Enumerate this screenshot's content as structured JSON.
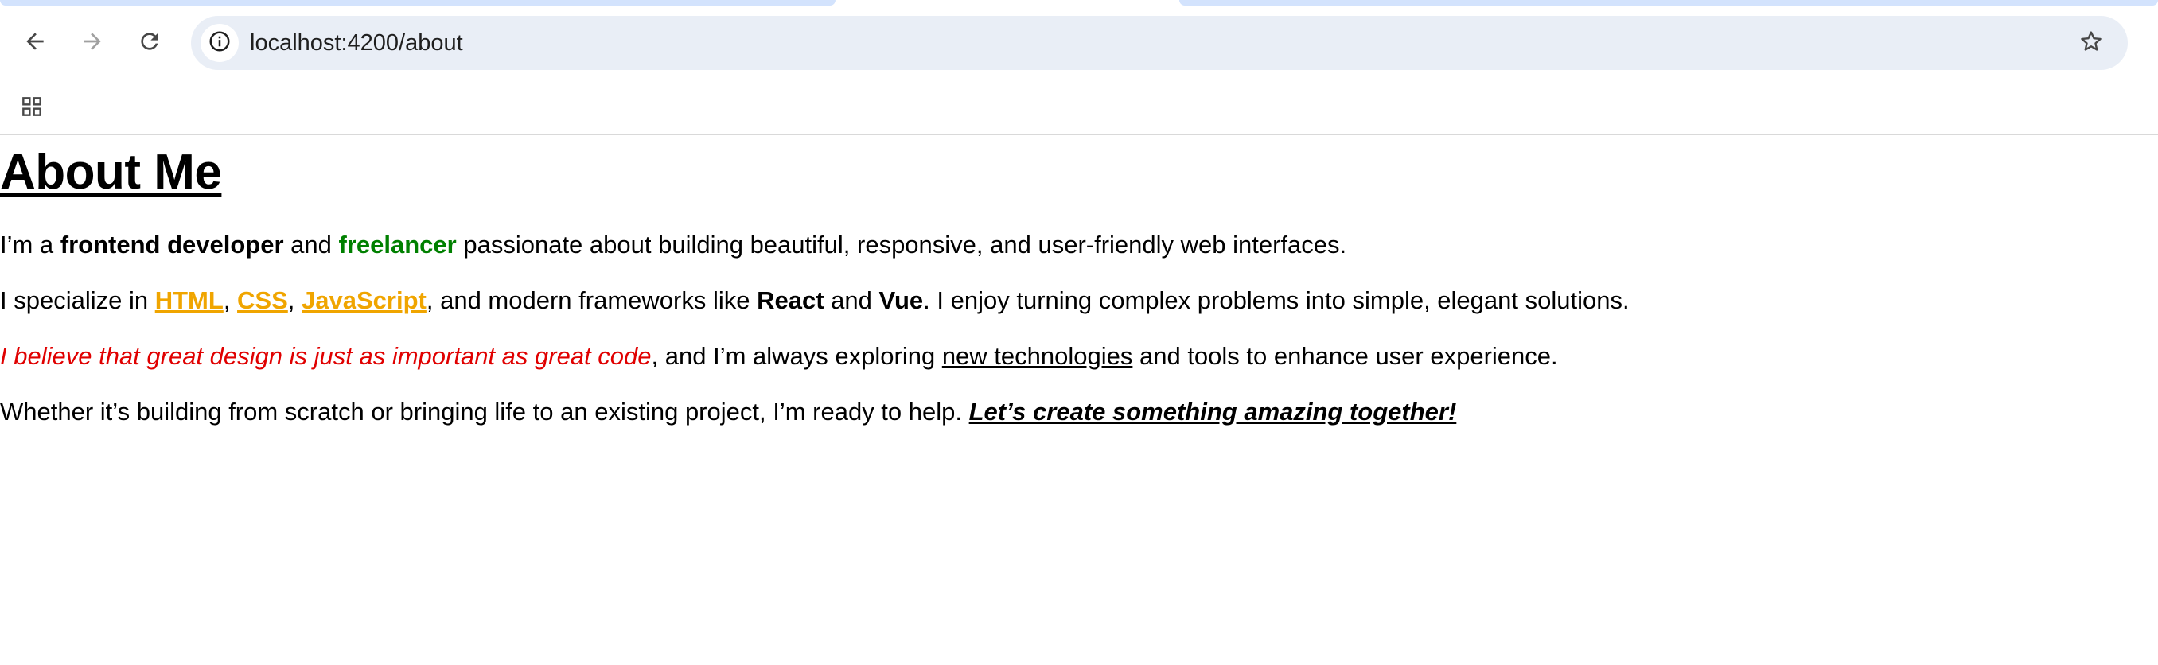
{
  "browser": {
    "url": "localhost:4200/about",
    "icons": {
      "back": "arrow-left-icon",
      "forward": "arrow-right-icon",
      "reload": "reload-icon",
      "site_info": "info-icon",
      "bookmark": "star-icon",
      "apps": "apps-grid-icon"
    }
  },
  "page": {
    "title": "About Me",
    "p1": {
      "t1": "I’m a ",
      "role": "frontend developer",
      "t2": " and ",
      "freelancer": "freelancer",
      "t3": " passionate about building beautiful, responsive, and user-friendly web interfaces."
    },
    "p2": {
      "t1": "I specialize in ",
      "html": "HTML",
      "sep1": ", ",
      "css": "CSS",
      "sep2": ", ",
      "js": "JavaScript",
      "t2": ", and modern frameworks like ",
      "react": "React",
      "t3": " and ",
      "vue": "Vue",
      "t4": ". I enjoy turning complex problems into simple, elegant solutions."
    },
    "p3": {
      "quote": "I believe that great design is just as important as great code",
      "t1": ", and I’m always exploring ",
      "link": "new technologies",
      "t2": " and tools to enhance user experience."
    },
    "p4": {
      "t1": "Whether it’s building from scratch or bringing life to an existing project, I’m ready to help. ",
      "cta": "Let’s create something amazing together!"
    }
  },
  "colors": {
    "accent_green": "#008000",
    "link_orange": "#f0a500",
    "quote_red": "#e00000",
    "omnibox_bg": "#e9eef6"
  }
}
